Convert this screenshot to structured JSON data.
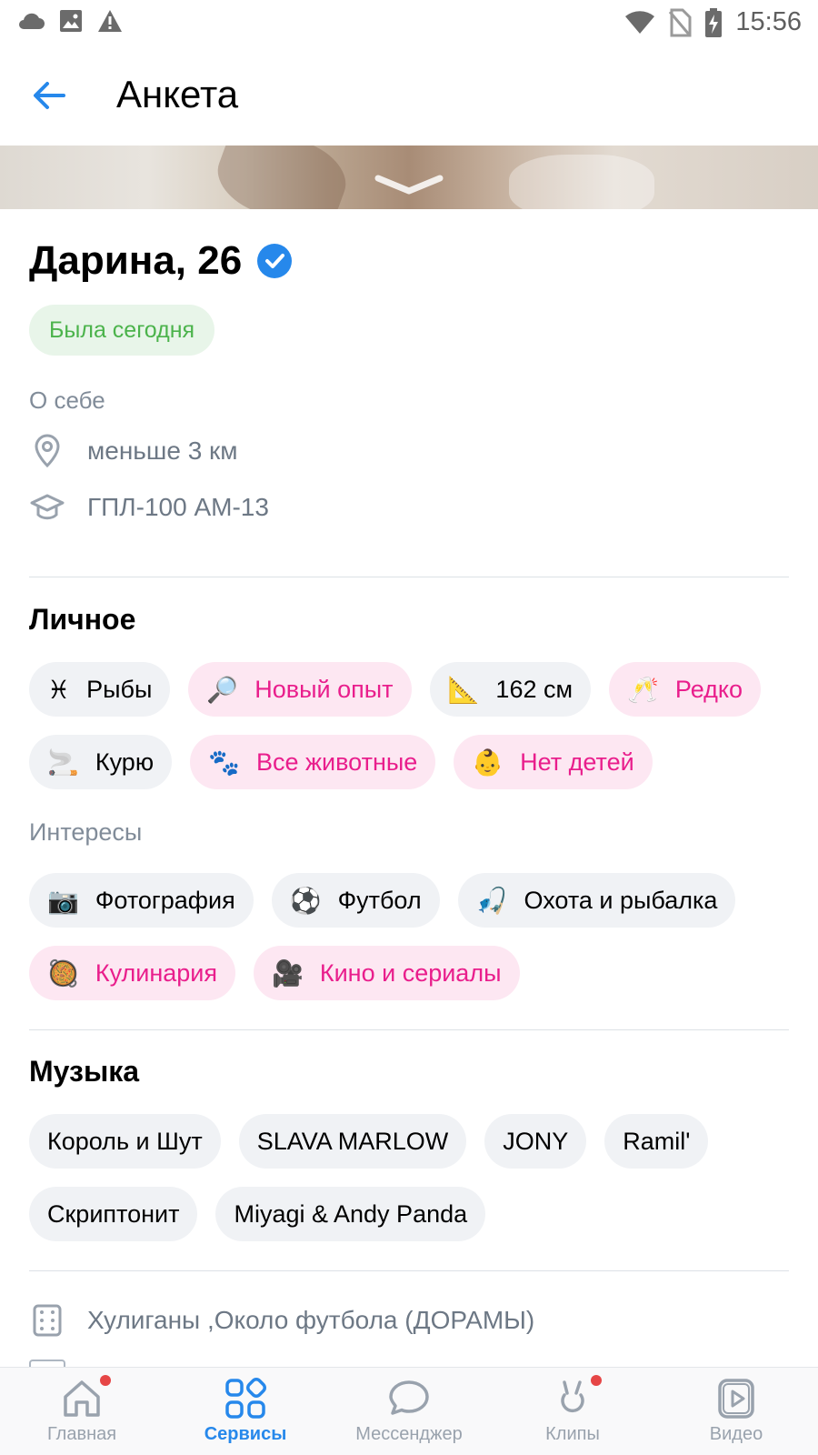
{
  "status_bar": {
    "time": "15:56",
    "left_icons": [
      "cloud-icon",
      "image-icon",
      "warning-icon"
    ],
    "right_icons": [
      "wifi-icon",
      "no-sim-icon",
      "battery-charging-icon"
    ]
  },
  "header": {
    "title": "Анкета",
    "back_icon": "arrow-left-icon"
  },
  "profile": {
    "name_age": "Дарина, 26",
    "verified": true,
    "online_status": "Была сегодня",
    "about_label": "О себе",
    "distance": "меньше 3 км",
    "education": "ГПЛ-100 АМ-13"
  },
  "personal": {
    "title": "Личное",
    "rows": [
      [
        {
          "emoji": "♓",
          "label": "Рыбы",
          "style": "gray"
        },
        {
          "emoji": "🔎",
          "label": "Новый опыт",
          "style": "pink"
        },
        {
          "emoji": "📐",
          "label": "162 см",
          "style": "gray"
        },
        {
          "emoji": "🥂",
          "label": "Редко",
          "style": "pink"
        }
      ],
      [
        {
          "emoji": "🚬",
          "label": "Курю",
          "style": "gray"
        },
        {
          "emoji": "🐾",
          "label": "Все животные",
          "style": "pink"
        },
        {
          "emoji": "👶",
          "label": "Нет детей",
          "style": "pink"
        }
      ]
    ]
  },
  "interests": {
    "title": "Интересы",
    "rows": [
      [
        {
          "emoji": "📷",
          "label": "Фотография",
          "style": "gray"
        },
        {
          "emoji": "⚽",
          "label": "Футбол",
          "style": "gray"
        },
        {
          "emoji": "🎣",
          "label": "Охота и рыбалка",
          "style": "gray"
        }
      ],
      [
        {
          "emoji": "🥘",
          "label": "Кулинария",
          "style": "pink"
        },
        {
          "emoji": "🎥",
          "label": "Кино и сериалы",
          "style": "pink"
        }
      ]
    ]
  },
  "music": {
    "title": "Музыка",
    "rows": [
      [
        {
          "label": "Король и Шут"
        },
        {
          "label": "SLAVA MARLOW"
        },
        {
          "label": "JONY"
        },
        {
          "label": "Ramil'"
        }
      ],
      [
        {
          "label": "Скриптонит"
        },
        {
          "label": "Miyagi & Andy Panda"
        }
      ]
    ]
  },
  "movies": {
    "text": "Хулиганы ,Около футбола (ДОРАМЫ)",
    "icon": "film-icon"
  },
  "tabbar": {
    "items": [
      {
        "label": "Главная",
        "icon": "home-icon",
        "active": false,
        "dot": true
      },
      {
        "label": "Сервисы",
        "icon": "services-icon",
        "active": true,
        "dot": false
      },
      {
        "label": "Мессенджер",
        "icon": "messenger-icon",
        "active": false,
        "dot": false
      },
      {
        "label": "Клипы",
        "icon": "clips-icon",
        "active": false,
        "dot": true
      },
      {
        "label": "Видео",
        "icon": "video-icon",
        "active": false,
        "dot": false
      }
    ]
  },
  "colors": {
    "accent": "#2688eb",
    "online_green": "#4bb34b",
    "pink_text": "#e91e8c",
    "pink_bg": "#fde7f2",
    "gray_chip_bg": "#f0f2f5",
    "secondary_text": "#818c99"
  }
}
